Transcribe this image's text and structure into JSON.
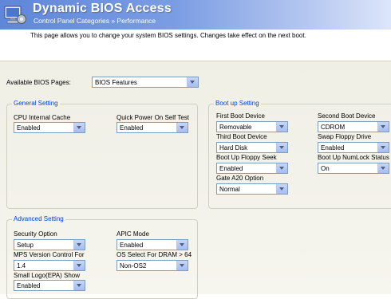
{
  "header": {
    "title": "Dynamic BIOS Access",
    "subtitle": "Control Panel Categories  »  Performance",
    "description": "This page allows you to change your system BIOS settings.  Changes take effect on the next boot."
  },
  "pages_selector": {
    "label": "Available BIOS Pages:",
    "value": "BIOS Features"
  },
  "general_setting": {
    "legend": "General Setting",
    "fields": [
      {
        "label": "CPU Internal Cache",
        "value": "Enabled"
      },
      {
        "label": "Quick Power On Self Test",
        "value": "Enabled"
      }
    ]
  },
  "boot_setting": {
    "legend": "Boot up Setting",
    "fields": [
      {
        "label": "First Boot Device",
        "value": "Removable"
      },
      {
        "label": "Second Boot Device",
        "value": "CDROM"
      },
      {
        "label": "Third Boot Device",
        "value": "Hard Disk"
      },
      {
        "label": "Swap Floppy Drive",
        "value": "Enabled"
      },
      {
        "label": "Boot Up Floppy Seek",
        "value": "Enabled"
      },
      {
        "label": "Boot Up NumLock Status",
        "value": "On"
      },
      {
        "label": "Gate A20 Option",
        "value": "Normal"
      }
    ]
  },
  "advanced_setting": {
    "legend": "Advanced Setting",
    "fields": [
      {
        "label": "Security Option",
        "value": "Setup"
      },
      {
        "label": "APIC Mode",
        "value": "Enabled"
      },
      {
        "label": "MPS Version Control For",
        "value": "1.4"
      },
      {
        "label": "OS Select For DRAM > 64",
        "value": "Non-OS2"
      },
      {
        "label": "Small Logo(EPA) Show",
        "value": "Enabled"
      }
    ]
  }
}
